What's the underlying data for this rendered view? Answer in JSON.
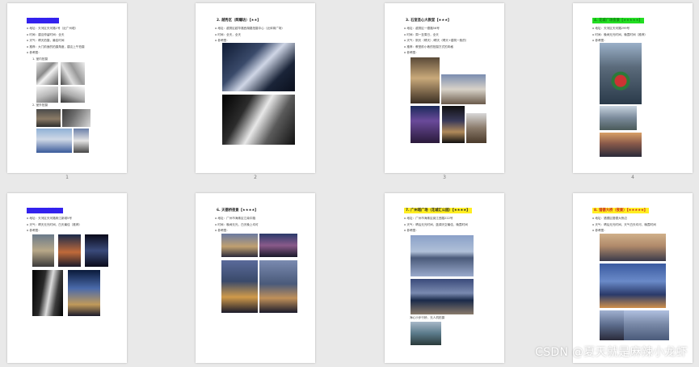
{
  "watermark": "CSDN @夏天就是麻辣小龙虾",
  "pages": [
    {
      "number": "1",
      "title": "1. 越秀区：镇海楼",
      "highlight": "#3322ee",
      "bullets": [
        "o 地址：天河区天河路1号（近广州塔）",
        "o 时间：建议停留时间：全天",
        "o 天气：晴天拍摄，最佳时间",
        "o 推荐：大门前面的拍摄角度，建议上午拍摄",
        "o 参考图："
      ],
      "subheads": [
        "1. 室内拍摄",
        "2. 室外拍摄"
      ]
    },
    {
      "number": "2",
      "title": "2. 越秀区（辉耀坊）【★★】",
      "highlight": "",
      "bullets": [
        "o 地址：越秀区越华路西湖路拍摄中心（近体育广场）",
        "o 时间：全天，全天",
        "o 参考图："
      ],
      "subheads": []
    },
    {
      "number": "3",
      "title": "3. 石室圣心大教堂【★★★】",
      "highlight": "",
      "bullets": [
        "o 地址：越秀区一德路56号",
        "o 时间：周一至周日，全天",
        "o 天气：阴天（晴天）/晴天（晴天+建筑一致的）",
        "o 推荐：教堂前小巷的拍摄方式的风格",
        "o 参考图："
      ],
      "subheads": []
    },
    {
      "number": "4",
      "title": "4. 花城广场夜景【★★★★★】",
      "highlight": "#22dd22",
      "bullets": [
        "o 地址：天河区天河路299号",
        "o 时间：晚间无光时间，晚霞时间（推荐）",
        "o 参考图："
      ],
      "subheads": []
    },
    {
      "number": "",
      "title": "5. 广州国际金融中心",
      "highlight": "#3322ee",
      "bullets": [
        "o 地址：天河区天河路珠江新城5号",
        "o 天气：晴天无光时间，白天最佳（推荐）",
        "o 参考图："
      ],
      "subheads": []
    },
    {
      "number": "",
      "title": "6. 天德桥夜景【★★★★】",
      "highlight": "",
      "bullets": [
        "o 地址：广州市海珠区江南中路",
        "o 时间：晚间无光，白天晚上均可",
        "o 参考图："
      ],
      "subheads": []
    },
    {
      "number": "",
      "title": "7. 广州塔广场（花城汇公园）【★★★★】",
      "highlight": "#ffee22",
      "bullets": [
        "o 地址：广州市海珠区阅江西路222号",
        "o 天气：晴后无光时间，蓝调天空最佳，晚霞时间",
        "o 参考图："
      ],
      "subheads": [
        "海心沙步行桥，无人机拍摄"
      ]
    },
    {
      "number": "",
      "title": "8. 猎德大桥（夜景）【★★★★★】",
      "highlight": "#ffee22",
      "bullets": [
        "o 地址：猎德区猎德大桥边",
        "o 天气：晴后无光时间，天气白天均可，晚霞时间",
        "o 参考图："
      ],
      "subheads": []
    }
  ]
}
